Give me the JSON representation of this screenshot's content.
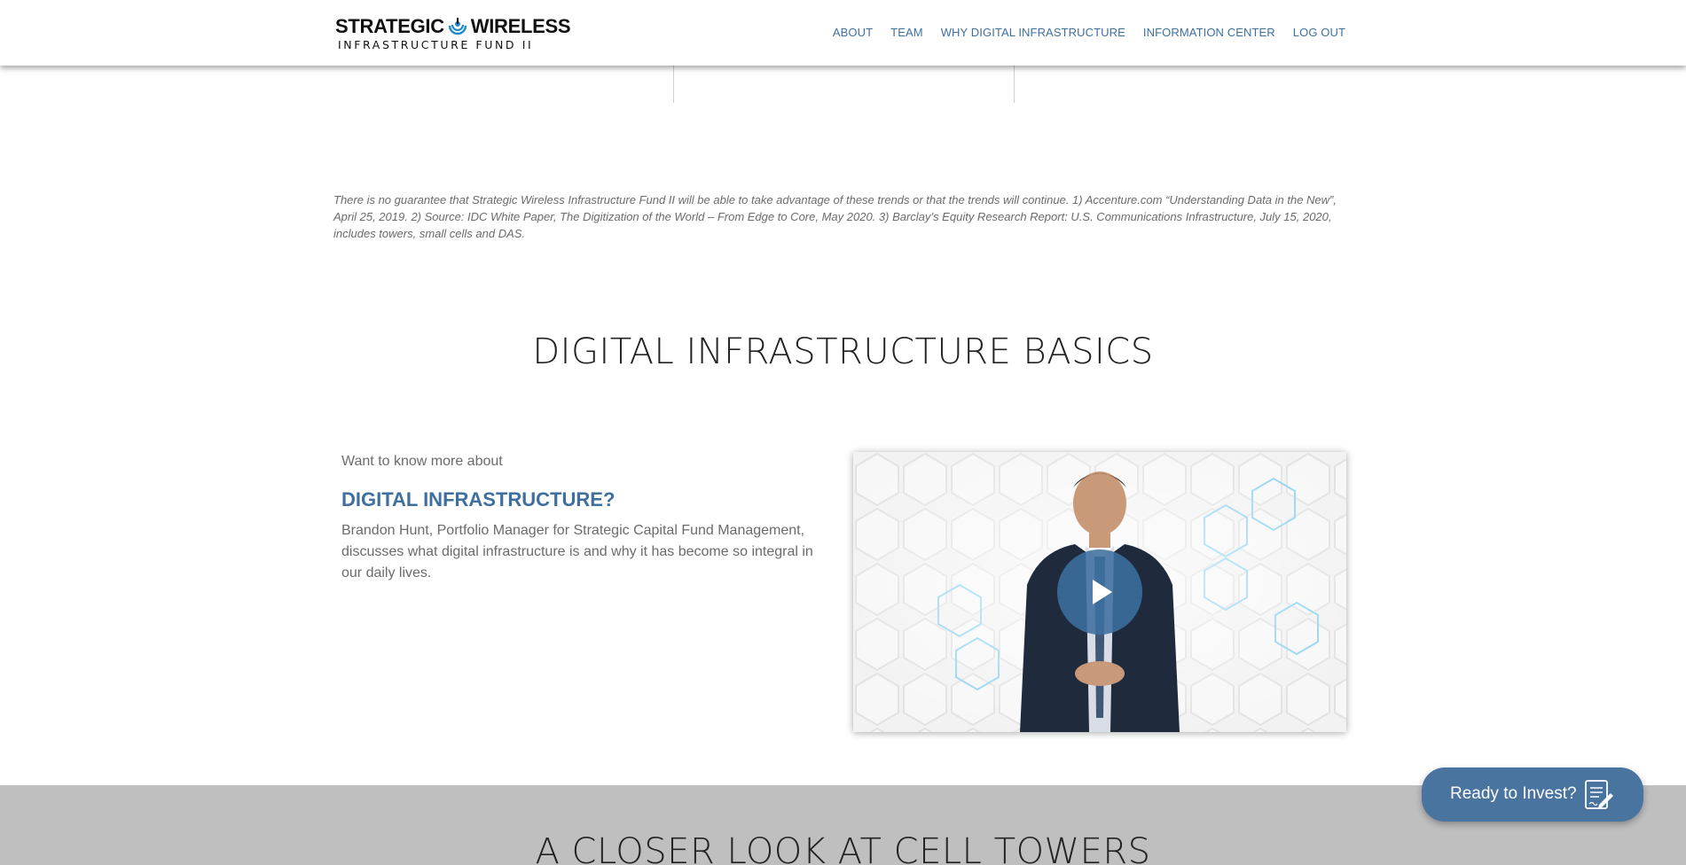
{
  "header": {
    "logo": {
      "line1_left": "STRATEGIC",
      "line1_right": "WIRELESS",
      "line2": "INFRASTRUCTURE FUND II"
    },
    "nav": [
      {
        "label": "ABOUT"
      },
      {
        "label": "TEAM"
      },
      {
        "label": "WHY DIGITAL INFRASTRUCTURE"
      },
      {
        "label": "INFORMATION CENTER"
      },
      {
        "label": "LOG OUT"
      }
    ]
  },
  "disclaimer": "There is no guarantee that Strategic Wireless Infrastructure Fund II will be able to take advantage of these trends or that the trends will continue. 1) Accenture.com “Understanding Data in the New”, April 25, 2019. 2) Source: IDC White Paper, The Digitization of the World – From Edge to Core, May 2020. 3) Barclay’s Equity Research Report: U.S. Communications Infrastructure, July 15, 2020, includes towers, small cells and DAS.",
  "basics": {
    "title": "DIGITAL INFRASTRUCTURE BASICS",
    "intro_small": "Want to know more about",
    "intro_heading": "DIGITAL INFRASTRUCTURE?",
    "intro_body": "Brandon Hunt, Portfolio Manager for Strategic Capital Fund Management, discusses what digital infrastructure is and why it has become so integral in our daily lives.",
    "video": {
      "play_icon": "play-icon"
    }
  },
  "towers": {
    "title": "A CLOSER LOOK AT CELL TOWERS"
  },
  "cta": {
    "label": "Ready to Invest?",
    "icon": "document-sign-icon"
  },
  "colors": {
    "accent": "#3e6f9f",
    "cta": "#4a74a0",
    "band": "#bfbfbf"
  }
}
